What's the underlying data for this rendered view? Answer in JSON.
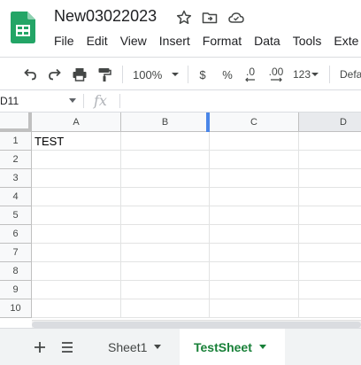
{
  "document": {
    "title": "New03022023"
  },
  "menu": {
    "items": [
      "File",
      "Edit",
      "View",
      "Insert",
      "Format",
      "Data",
      "Tools",
      "Exte"
    ]
  },
  "toolbar": {
    "zoom": "100%",
    "currency": "$",
    "percent": "%",
    "decrease_decimal": ".0",
    "increase_decimal": ".00",
    "more_formats": "123",
    "default_font": "Defa"
  },
  "formula_bar": {
    "name_box": "D11",
    "fx": "fx",
    "value": ""
  },
  "grid": {
    "columns": [
      "A",
      "B",
      "C",
      "D"
    ],
    "rows": [
      "1",
      "2",
      "3",
      "4",
      "5",
      "6",
      "7",
      "8",
      "9",
      "10"
    ],
    "cells": {
      "A1": "TEST"
    }
  },
  "sheets": {
    "tabs": [
      {
        "label": "Sheet1",
        "active": false
      },
      {
        "label": "TestSheet",
        "active": true
      }
    ]
  },
  "colors": {
    "accent_green": "#188038",
    "logo_green": "#23a566",
    "selection_blue": "#4a86e8"
  }
}
